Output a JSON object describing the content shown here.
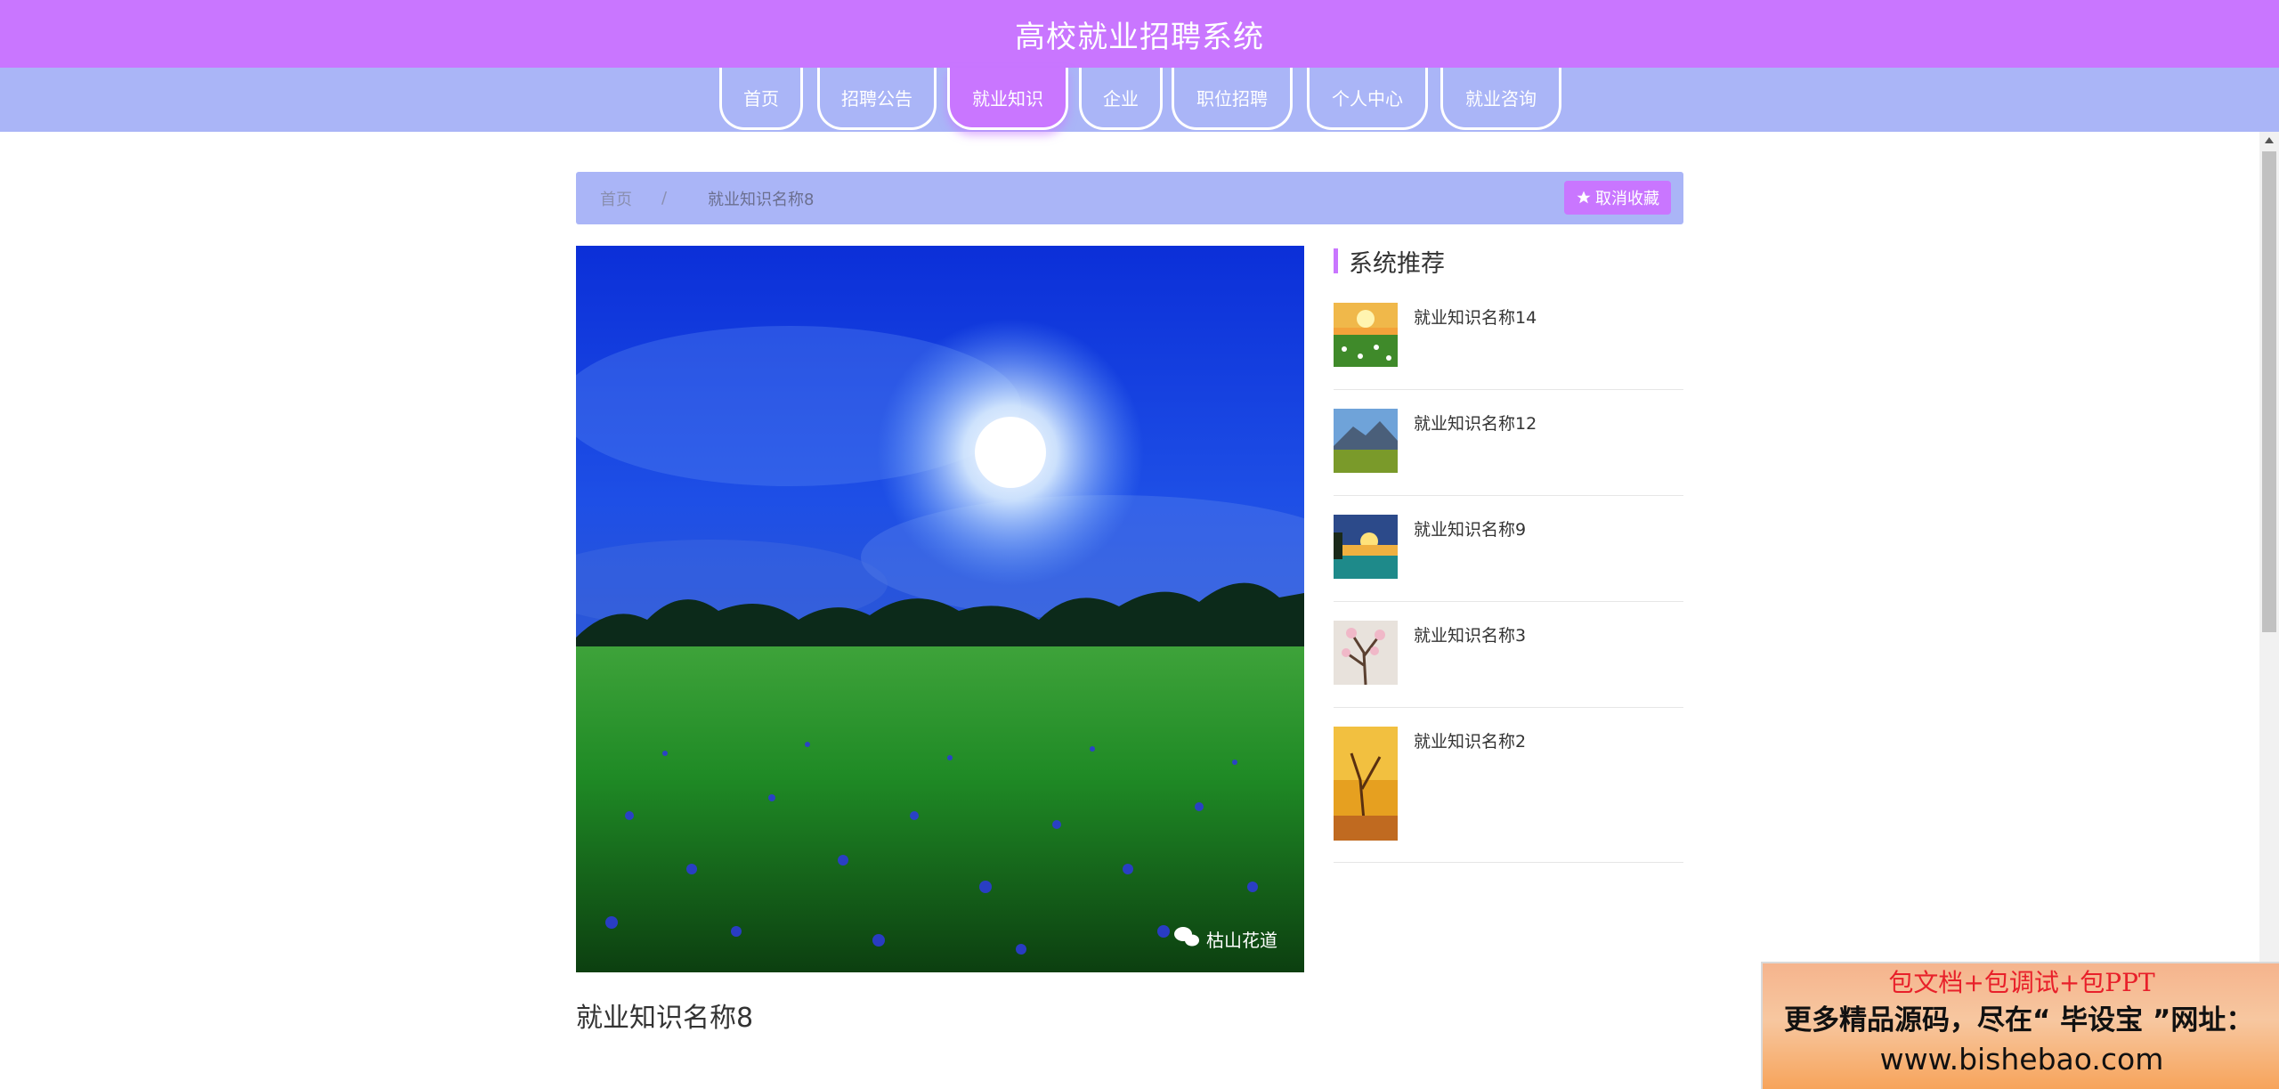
{
  "header": {
    "title": "高校就业招聘系统"
  },
  "nav": {
    "items": [
      {
        "label": "首页",
        "active": false
      },
      {
        "label": "招聘公告",
        "active": false
      },
      {
        "label": "就业知识",
        "active": true
      },
      {
        "label": "企业",
        "active": false
      },
      {
        "label": "职位招聘",
        "active": false
      },
      {
        "label": "个人中心",
        "active": false
      },
      {
        "label": "就业咨询",
        "active": false
      }
    ]
  },
  "breadcrumb": {
    "home": "首页",
    "separator": "/",
    "current": "就业知识名称8",
    "favorite_button": "取消收藏",
    "favorite_icon": "star-icon"
  },
  "main": {
    "image_watermark": "枯山花道",
    "watermark_icon": "wechat-icon",
    "title": "就业知识名称8"
  },
  "recommend": {
    "title": "系统推荐",
    "items": [
      {
        "label": "就业知识名称14"
      },
      {
        "label": "就业知识名称12"
      },
      {
        "label": "就业知识名称9"
      },
      {
        "label": "就业知识名称3"
      },
      {
        "label": "就业知识名称2"
      }
    ]
  },
  "ad": {
    "line1": "包文档+包调试+包PPT",
    "line2": "更多精品源码，尽在“ 毕设宝 ”网址：",
    "line3": "www.bishebao.com"
  },
  "colors": {
    "primary": "#c976ff",
    "secondary": "#aab5f7",
    "ad_text_red": "#e8202a"
  }
}
